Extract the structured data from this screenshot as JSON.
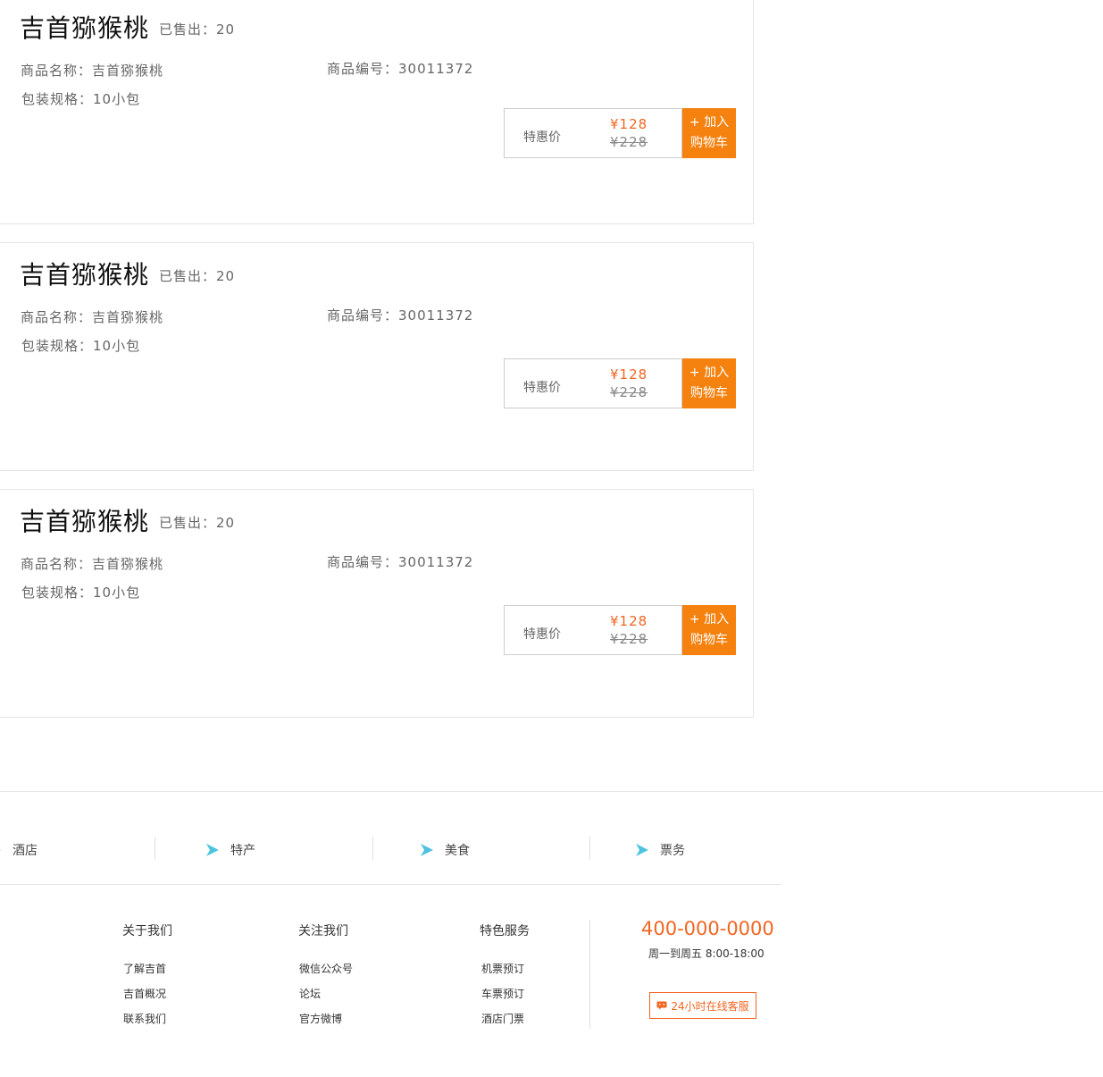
{
  "products": [
    {
      "title": "吉首猕猴桃",
      "sold": "已售出：20",
      "name": "商品名称：吉首猕猴桃",
      "code": "商品编号：30011372",
      "spec": "包装规格：10小包",
      "price_label": "特惠价",
      "price_now": "¥128",
      "price_old": "¥228",
      "cart_line1": "+ 加入",
      "cart_line2": "购物车"
    },
    {
      "title": "吉首猕猴桃",
      "sold": "已售出：20",
      "name": "商品名称：吉首猕猴桃",
      "code": "商品编号：30011372",
      "spec": "包装规格：10小包",
      "price_label": "特惠价",
      "price_now": "¥128",
      "price_old": "¥228",
      "cart_line1": "+ 加入",
      "cart_line2": "购物车"
    },
    {
      "title": "吉首猕猴桃",
      "sold": "已售出：20",
      "name": "商品名称：吉首猕猴桃",
      "code": "商品编号：30011372",
      "spec": "包装规格：10小包",
      "price_label": "特惠价",
      "price_now": "¥128",
      "price_old": "¥228",
      "cart_line1": "+ 加入",
      "cart_line2": "购物车"
    }
  ],
  "categories": [
    {
      "label": "酒店",
      "icon": "arrow-icon"
    },
    {
      "label": "特产",
      "icon": "arrow-icon"
    },
    {
      "label": "美食",
      "icon": "arrow-icon"
    },
    {
      "label": "票务",
      "icon": "arrow-icon"
    }
  ],
  "footer": {
    "columns": [
      {
        "title": "关于我们",
        "links": [
          "了解吉首",
          "吉首概况",
          "联系我们"
        ]
      },
      {
        "title": "关注我们",
        "links": [
          "微信公众号",
          "论坛",
          "官方微博"
        ]
      },
      {
        "title": "特色服务",
        "links": [
          "机票预订",
          "车票预订",
          "酒店门票"
        ]
      }
    ],
    "phone": "400-000-0000",
    "hours": "周一到周五 8:00-18:00",
    "service_label": "24小时在线客服"
  },
  "colors": {
    "accent": "#f26522",
    "cart_button": "#f5810f",
    "arrow": "#4ec3e0"
  }
}
